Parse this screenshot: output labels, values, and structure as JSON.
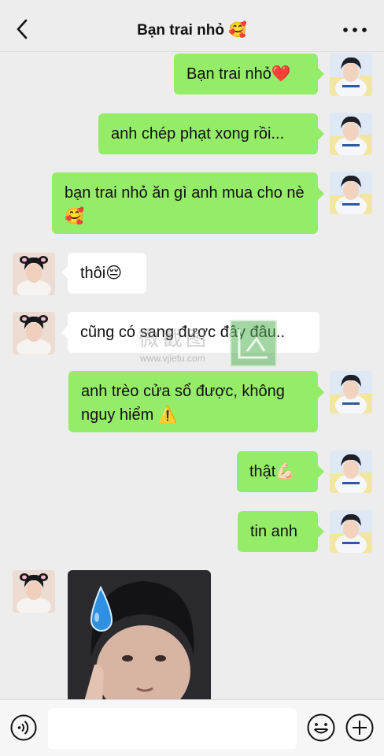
{
  "header": {
    "title": "Bạn trai nhỏ 🥰"
  },
  "messages": [
    {
      "from": "me",
      "text": "Bạn trai nhỏ❤️"
    },
    {
      "from": "me",
      "text": "anh chép phạt xong rồi..."
    },
    {
      "from": "me",
      "text": "bạn trai nhỏ ăn gì anh mua cho nè🥰"
    },
    {
      "from": "them",
      "text": "thôi😔"
    },
    {
      "from": "them",
      "text": "cũng có sang được đây đâu.."
    },
    {
      "from": "me",
      "text": "anh trèo cửa sổ được, không nguy hiểm ⚠️"
    },
    {
      "from": "me",
      "text": "thật💪🏻"
    },
    {
      "from": "me",
      "text": "tin anh"
    },
    {
      "from": "them",
      "type": "sticker",
      "sticker": "sweat-drop"
    }
  ],
  "watermark": {
    "text": "微截图",
    "url": "www.vjietu.com"
  },
  "input": {
    "value": "",
    "placeholder": ""
  },
  "icons": {
    "back": "chevron-left-icon",
    "more": "more-dots-icon",
    "voice": "voice-icon",
    "emoji": "emoji-icon",
    "plus": "plus-icon"
  },
  "colors": {
    "bubble_me": "#95ec69",
    "bubble_them": "#ffffff",
    "background": "#ededed"
  }
}
